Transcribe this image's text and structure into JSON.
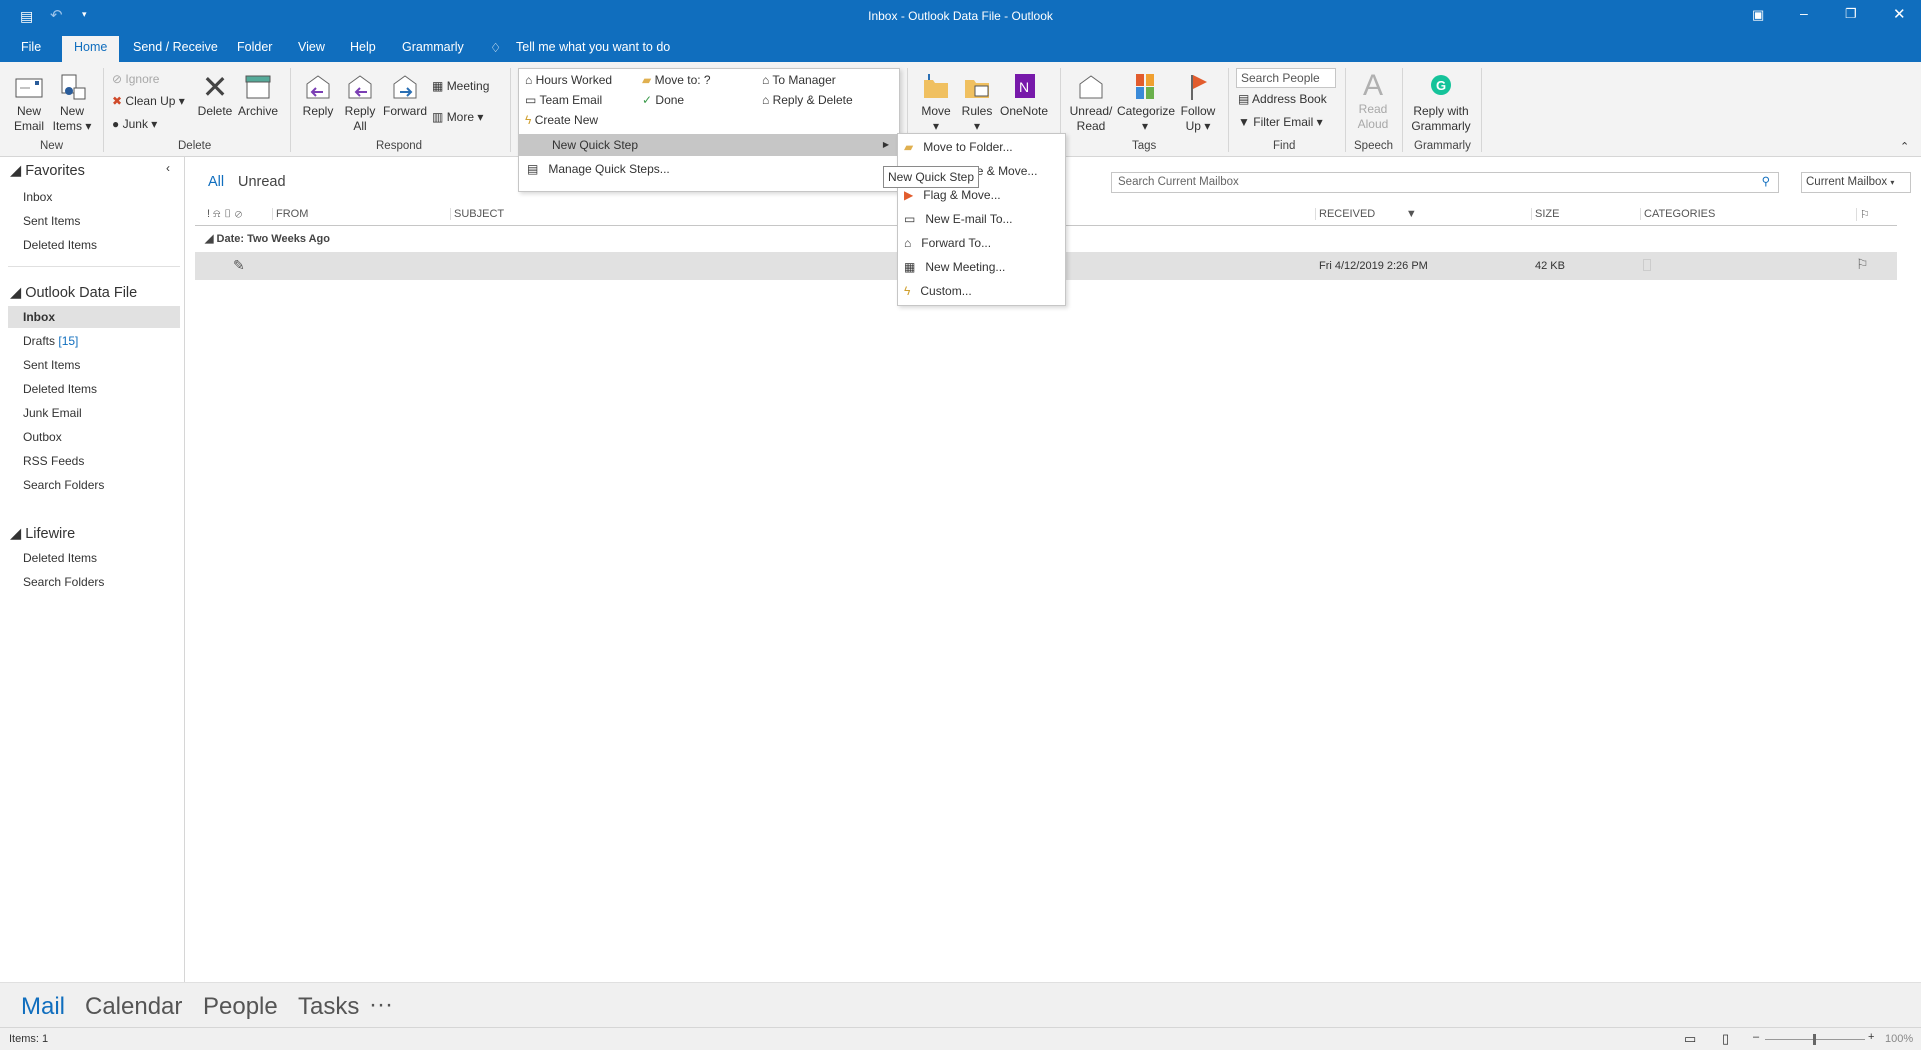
{
  "window": {
    "title": "Inbox - Outlook Data File  -  Outlook"
  },
  "tabs": [
    {
      "label": "File"
    },
    {
      "label": "Home"
    },
    {
      "label": "Send / Receive"
    },
    {
      "label": "Folder"
    },
    {
      "label": "View"
    },
    {
      "label": "Help"
    },
    {
      "label": "Grammarly"
    }
  ],
  "tell_me": "Tell me what you want to do",
  "ribbon": {
    "new": {
      "new_email": "New Email",
      "new_items": "New Items",
      "group": "New"
    },
    "delete": {
      "ignore": "Ignore",
      "clean_up": "Clean Up",
      "junk": "Junk",
      "delete": "Delete",
      "archive": "Archive",
      "group": "Delete"
    },
    "respond": {
      "reply": "Reply",
      "reply_all": "Reply All",
      "forward": "Forward",
      "meeting": "Meeting",
      "more": "More",
      "group": "Respond"
    },
    "quick_steps": [
      "Hours Worked",
      "Move to: ?",
      "To Manager",
      "Team Email",
      "Done",
      "Reply & Delete",
      "Create New"
    ],
    "move": {
      "move": "Move",
      "rules": "Rules",
      "onenote": "OneNote"
    },
    "tags": {
      "unread": "Unread/ Read",
      "categorize": "Categorize",
      "follow_up": "Follow Up",
      "group": "Tags"
    },
    "find": {
      "search_people": "Search People",
      "address_book": "Address Book",
      "filter_email": "Filter Email",
      "group": "Find"
    },
    "speech": {
      "read_aloud": "Read Aloud",
      "group": "Speech"
    },
    "grammarly": {
      "reply": "Reply with Grammarly",
      "group": "Grammarly"
    }
  },
  "quick_steps_menu": {
    "new_quick_step": "New Quick Step",
    "manage": "Manage Quick Steps..."
  },
  "submenu": [
    "Move to Folder...",
    "Categorize & Move...",
    "Flag & Move...",
    "New E-mail To...",
    "Forward To...",
    "New Meeting...",
    "Custom..."
  ],
  "tooltip": "New Quick Step",
  "nav": {
    "favorites": {
      "title": "Favorites",
      "items": [
        "Inbox",
        "Sent Items",
        "Deleted Items"
      ]
    },
    "datafile": {
      "title": "Outlook Data File",
      "items": [
        "Inbox",
        "Drafts",
        "Sent Items",
        "Deleted Items",
        "Junk Email",
        "Outbox",
        "RSS Feeds",
        "Search Folders"
      ],
      "drafts_count": "[15]"
    },
    "lifewire": {
      "title": "Lifewire",
      "items": [
        "Deleted Items",
        "Search Folders"
      ]
    }
  },
  "filters": {
    "all": "All",
    "unread": "Unread"
  },
  "search": {
    "placeholder": "Search Current Mailbox",
    "scope": "Current Mailbox"
  },
  "columns": {
    "from": "FROM",
    "subject": "SUBJECT",
    "received": "RECEIVED",
    "size": "SIZE",
    "categories": "CATEGORIES"
  },
  "group_header": "Date: Two Weeks Ago",
  "message": {
    "received": "Fri 4/12/2019 2:26 PM",
    "size": "42 KB"
  },
  "bottom_nav": [
    "Mail",
    "Calendar",
    "People",
    "Tasks",
    "···"
  ],
  "status": {
    "items": "Items: 1",
    "zoom": "100%"
  },
  "colors": {
    "accent": "#106ebe"
  }
}
